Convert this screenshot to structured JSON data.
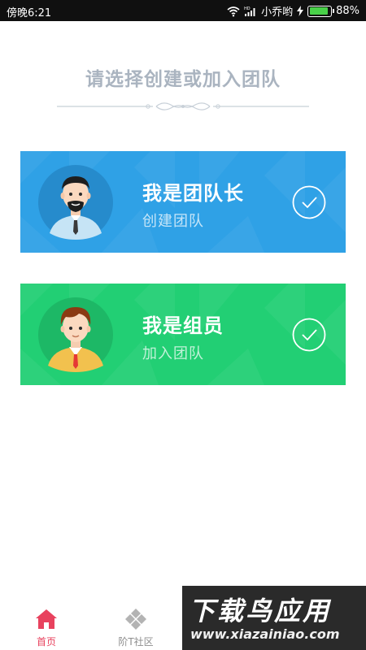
{
  "status_bar": {
    "time": "傍晚6:21",
    "signal_label": "HD",
    "carrier": "小乔哟",
    "battery_percent": "88%",
    "battery_level": 0.88
  },
  "page": {
    "title": "请选择创建或加入团队"
  },
  "roles": [
    {
      "title": "我是团队长",
      "subtitle": "创建团队",
      "color": "#2fa1e6",
      "icon": "leader-avatar"
    },
    {
      "title": "我是组员",
      "subtitle": "加入团队",
      "color": "#22cf74",
      "icon": "member-avatar"
    }
  ],
  "bottom_nav": {
    "tabs": [
      {
        "label": "首页",
        "icon": "home-icon",
        "active": true,
        "color": "#e8425e"
      },
      {
        "label": "阶T社区",
        "icon": "community-icon",
        "active": false,
        "color": "#8e8e8e"
      }
    ]
  },
  "watermark": {
    "brand": "下载鸟应用",
    "url": "www.xiazainiao.com"
  }
}
